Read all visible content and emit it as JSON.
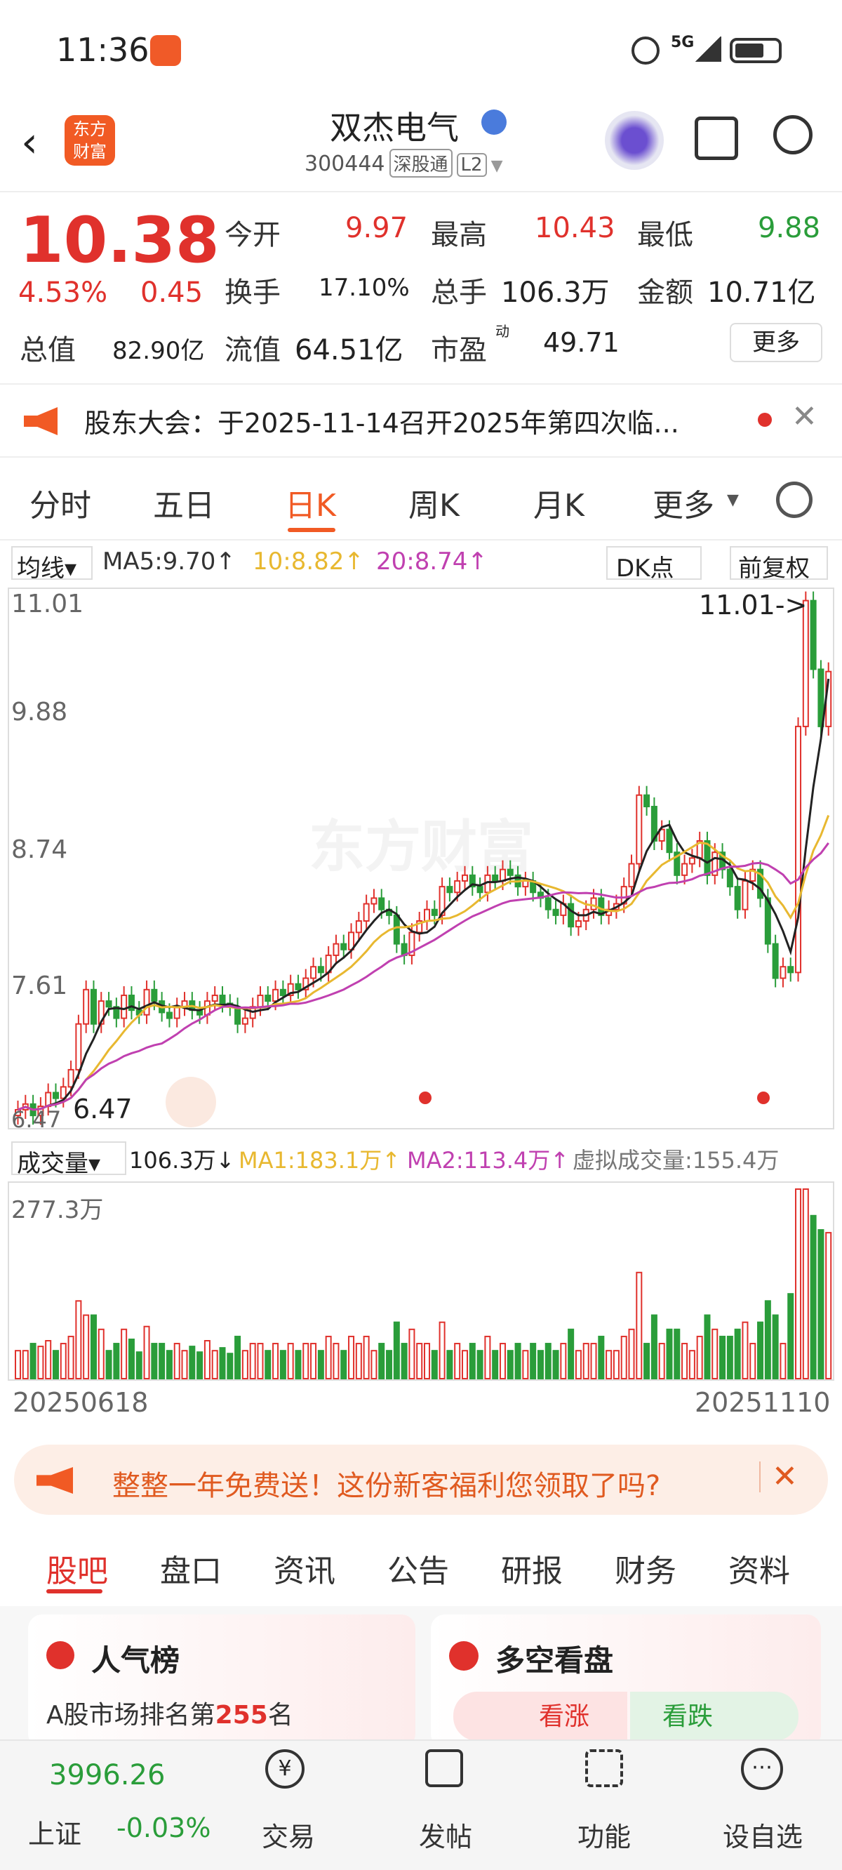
{
  "status": {
    "time": "11:36",
    "network": "5G"
  },
  "header": {
    "logo": "东方\n财富",
    "stock_name": "双杰电气",
    "code": "300444",
    "tag1": "深股通",
    "tag2": "L2"
  },
  "quote": {
    "price": "10.38",
    "pct": "4.53%",
    "chg": "0.45",
    "open_label": "今开",
    "open": "9.97",
    "high_label": "最高",
    "high": "10.43",
    "low_label": "最低",
    "low": "9.88",
    "turnover_label": "换手",
    "turnover": "17.10%",
    "vol_label": "总手",
    "vol": "106.3万",
    "amt_label": "金额",
    "amt": "10.71亿",
    "mcap_label": "总值",
    "mcap": "82.90亿",
    "float_label": "流值",
    "float": "64.51亿",
    "pe_label": "市盈",
    "pe_sup": "动",
    "pe": "49.71",
    "more": "更多"
  },
  "notice": {
    "text": "股东大会：于2025-11-14召开2025年第四次临..."
  },
  "tabs": [
    "分时",
    "五日",
    "日K",
    "周K",
    "月K",
    "更多"
  ],
  "ma": {
    "label": "均线",
    "ma5": "MA5:9.70↑",
    "ma10": "10:8.82↑",
    "ma20": "20:8.74↑",
    "dk": "DK点",
    "fq": "前复权"
  },
  "chart_data": {
    "type": "candlestick",
    "y_ticks": [
      "11.01",
      "9.88",
      "8.74",
      "7.61",
      "6.47"
    ],
    "ylim": [
      6.47,
      11.01
    ],
    "high_label": "11.01->",
    "low_label": "6.47",
    "closes": [
      6.55,
      6.6,
      6.5,
      6.58,
      6.7,
      6.65,
      6.75,
      6.9,
      7.3,
      7.6,
      7.3,
      7.5,
      7.45,
      7.35,
      7.55,
      7.42,
      7.38,
      7.6,
      7.5,
      7.4,
      7.35,
      7.45,
      7.5,
      7.42,
      7.38,
      7.5,
      7.55,
      7.48,
      7.45,
      7.3,
      7.35,
      7.45,
      7.55,
      7.5,
      7.6,
      7.55,
      7.65,
      7.6,
      7.7,
      7.8,
      7.75,
      7.9,
      8.0,
      7.95,
      8.1,
      8.2,
      8.35,
      8.4,
      8.3,
      8.25,
      8.0,
      7.9,
      8.1,
      8.2,
      8.3,
      8.25,
      8.5,
      8.45,
      8.55,
      8.6,
      8.5,
      8.45,
      8.6,
      8.55,
      8.65,
      8.6,
      8.5,
      8.55,
      8.45,
      8.4,
      8.3,
      8.25,
      8.35,
      8.15,
      8.2,
      8.3,
      8.4,
      8.25,
      8.3,
      8.35,
      8.5,
      8.7,
      9.3,
      9.2,
      8.9,
      9.0,
      8.8,
      8.6,
      8.7,
      8.75,
      8.9,
      8.6,
      8.8,
      8.65,
      8.5,
      8.3,
      8.55,
      8.65,
      8.4,
      8.0,
      7.7,
      7.8,
      7.75,
      9.9,
      11.0,
      10.4,
      9.9,
      10.38
    ]
  },
  "volume": {
    "label": "成交量",
    "cur": "106.3万↓",
    "ma1": "MA1:183.1万↑",
    "ma2": "MA2:113.4万↑",
    "virtual": "虚拟成交量:155.4万",
    "max": "277.3万",
    "start": "20250618",
    "end": "20251110"
  },
  "ad": {
    "text": "整整一年免费送！这份新客福利您领取了吗?"
  },
  "bottom_tabs": [
    "股吧",
    "盘口",
    "资讯",
    "公告",
    "研报",
    "财务",
    "资料"
  ],
  "cards": {
    "rank_title": "人气榜",
    "rank_text": "A股市场排名第",
    "rank_num": "255",
    "rank_unit": "名",
    "vs_title": "多空看盘",
    "bull": "看涨",
    "bear": "看跌"
  },
  "nav": {
    "index_val": "3996.26",
    "index_name": "上证",
    "index_chg": "-0.03%",
    "trade": "交易",
    "post": "发帖",
    "func": "功能",
    "watch": "设自选"
  }
}
